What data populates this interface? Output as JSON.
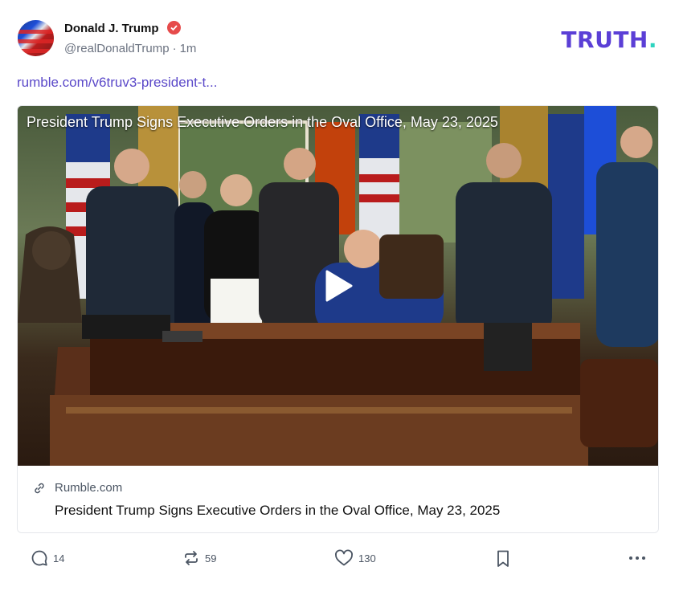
{
  "post": {
    "author_name": "Donald J. Trump",
    "handle": "@realDonaldTrump",
    "separator": "·",
    "time": "1m",
    "link_text": "rumble.com/v6truv3-president-t..."
  },
  "brand": {
    "logo_text": "TRUTH",
    "logo_dot": ".",
    "accent": "#5b3fd6",
    "dot_color": "#2dd4bf"
  },
  "card": {
    "video_title": "President Trump Signs Executive Orders in the Oval Office, May 23, 2025",
    "site": "Rumble.com",
    "title": "President Trump Signs Executive Orders in the Oval Office, May 23, 2025"
  },
  "actions": {
    "replies": "14",
    "reposts": "59",
    "likes": "130"
  },
  "icons": [
    "verified-icon",
    "link-icon",
    "play-icon",
    "reply-icon",
    "repost-icon",
    "like-icon",
    "bookmark-icon",
    "more-icon"
  ]
}
